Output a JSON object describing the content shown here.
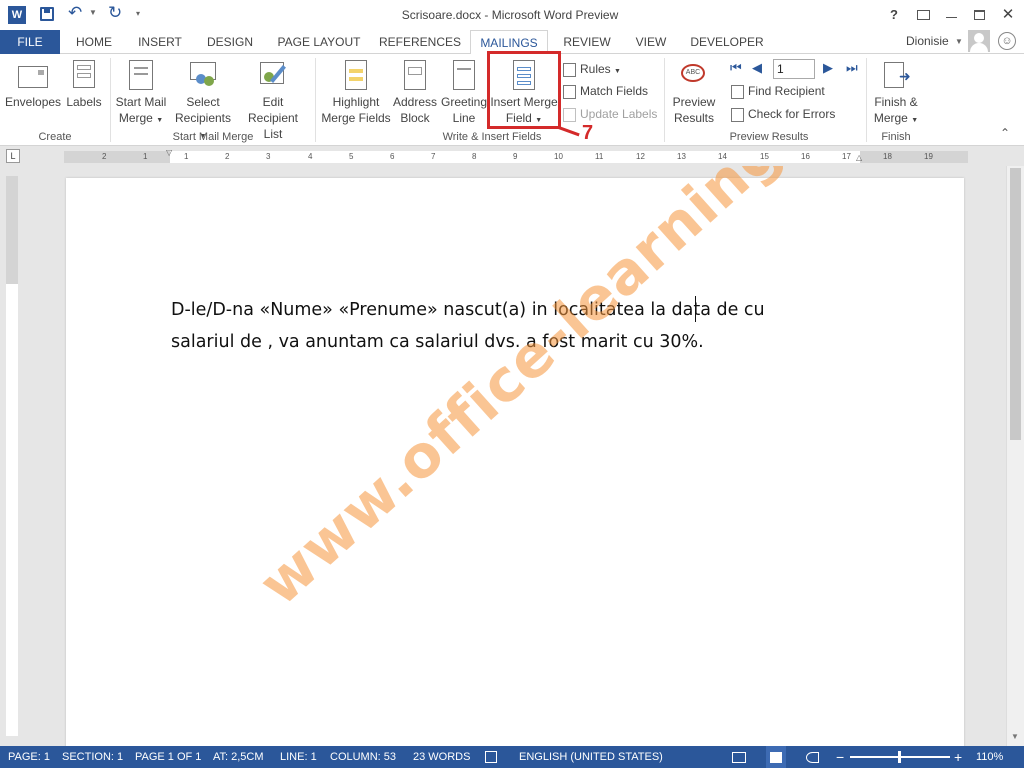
{
  "window": {
    "title": "Scrisoare.docx - Microsoft Word Preview",
    "help": "?",
    "user": "Dionisie"
  },
  "tabs": [
    "FILE",
    "HOME",
    "INSERT",
    "DESIGN",
    "PAGE LAYOUT",
    "REFERENCES",
    "MAILINGS",
    "REVIEW",
    "VIEW",
    "DEVELOPER"
  ],
  "active_tab": "MAILINGS",
  "ribbon": {
    "create": {
      "label": "Create",
      "envelopes": "Envelopes",
      "labels": "Labels"
    },
    "start_mail_merge": {
      "label": "Start Mail Merge",
      "start_line1": "Start Mail",
      "start_line2": "Merge",
      "select_line1": "Select",
      "select_line2": "Recipients",
      "edit_line1": "Edit",
      "edit_line2": "Recipient List"
    },
    "write_insert": {
      "label": "Write & Insert Fields",
      "highlight_line1": "Highlight",
      "highlight_line2": "Merge Fields",
      "address_line1": "Address",
      "address_line2": "Block",
      "greeting_line1": "Greeting",
      "greeting_line2": "Line",
      "insert_line1": "Insert Merge",
      "insert_line2": "Field",
      "rules": "Rules",
      "match_fields": "Match Fields",
      "update_labels": "Update Labels"
    },
    "preview": {
      "label": "Preview Results",
      "preview_line1": "Preview",
      "preview_line2": "Results",
      "record": "1",
      "find_recipient": "Find Recipient",
      "check_errors": "Check for Errors"
    },
    "finish": {
      "label": "Finish",
      "finish_line1": "Finish &",
      "finish_line2": "Merge"
    },
    "annotation_number": "7"
  },
  "ruler": {
    "numbers": [
      "2",
      "1",
      "1",
      "2",
      "3",
      "4",
      "5",
      "6",
      "7",
      "8",
      "9",
      "10",
      "11",
      "12",
      "13",
      "14",
      "15",
      "16",
      "17",
      "18",
      "19"
    ]
  },
  "document": {
    "line1": "D-le/D-na «Nume» «Prenume» nascut(a) in localitatea la data de  cu",
    "line2": "salariul de , va anuntam ca salariul dvs. a fost marit cu 30%.",
    "watermark": "www.office-learning.ro"
  },
  "statusbar": {
    "page": "PAGE: 1",
    "section": "SECTION: 1",
    "pageof": "PAGE 1 OF 1",
    "at": "AT: 2,5CM",
    "line": "LINE: 1",
    "column": "COLUMN: 53",
    "words": "23 WORDS",
    "language": "ENGLISH (UNITED STATES)",
    "zoom": "110%"
  },
  "colors": {
    "accent": "#2b579a",
    "annotation": "#d42a2a",
    "watermark": "#f5963c"
  }
}
